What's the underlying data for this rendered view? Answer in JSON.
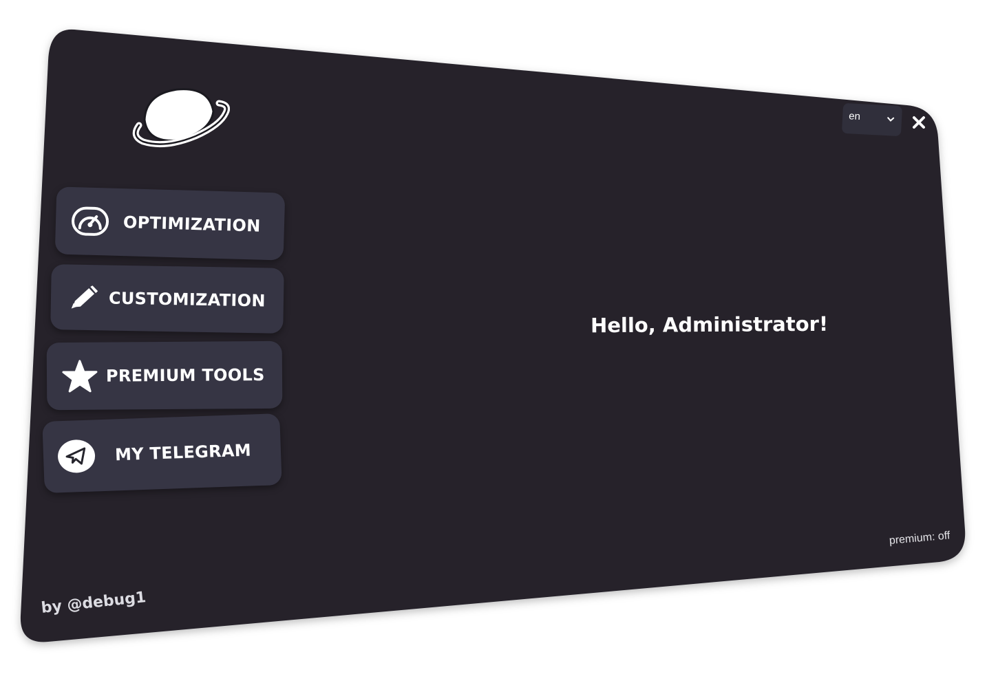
{
  "app": {
    "logo_icon": "saturn-planet-icon",
    "background_color": "#25242c",
    "button_color": "#363544"
  },
  "nav": {
    "items": [
      {
        "label": "OPTIMIZATION",
        "icon": "speedometer-icon"
      },
      {
        "label": "CUSTOMIZATION",
        "icon": "pencil-icon"
      },
      {
        "label": "PREMIUM TOOLS",
        "icon": "star-icon"
      },
      {
        "label": "MY TELEGRAM",
        "icon": "telegram-icon"
      }
    ]
  },
  "header": {
    "language": {
      "selected": "en",
      "icon": "chevron-down-icon"
    },
    "close_icon": "close-icon"
  },
  "main": {
    "greeting": "Hello, Administrator!"
  },
  "status": {
    "premium": "premium: off"
  },
  "footer": {
    "author": "by @debug1"
  }
}
